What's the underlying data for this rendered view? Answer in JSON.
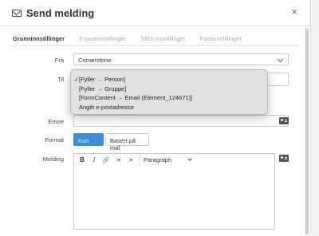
{
  "dialog": {
    "title": "Send melding",
    "close_glyph": "×",
    "icon": "envelope-icon"
  },
  "tabs": [
    {
      "label": "Grunninnstillinger",
      "active": true
    },
    {
      "label": "E-postinnstillinger",
      "active": false
    },
    {
      "label": "SMS-innstillinger",
      "active": false
    },
    {
      "label": "Postinnstillinger",
      "active": false
    }
  ],
  "form": {
    "fra_label": "Fra",
    "fra_value": "Cornerstone",
    "til_label": "Til",
    "emne_label": "Emne",
    "emne_value": "",
    "format_label": "Format",
    "melding_label": "Melding"
  },
  "dropdown": {
    "options": [
      {
        "label": "[Fyller → Person]",
        "checked": true,
        "check_glyph": "✓"
      },
      {
        "label": "[Fyller → Gruppe]",
        "checked": false,
        "check_glyph": ""
      },
      {
        "label": "[FormContent → Email (Element_124671)]",
        "checked": false,
        "check_glyph": ""
      },
      {
        "label": "Angitt e-postadresse",
        "checked": false,
        "check_glyph": ""
      }
    ]
  },
  "format_buttons": {
    "primary": "Kun tekst",
    "secondary": "Basert på mal"
  },
  "toolbar": {
    "bold": "B",
    "italic": "I",
    "link": "🔗",
    "ordered_list": "⁝≡",
    "bullet_list": "⁚≡",
    "paragraph": "Paragraph"
  },
  "colors": {
    "accent": "#3e8dd8",
    "chevron": "#2b5fbf",
    "dropdown_bg": "#e3e1df"
  }
}
